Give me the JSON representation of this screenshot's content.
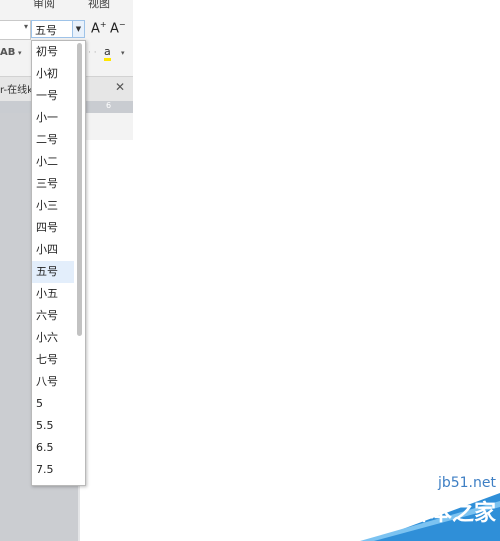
{
  "ribbon": {
    "tabs": [
      {
        "label": "审阅"
      },
      {
        "label": "视图"
      }
    ]
  },
  "toolbar": {
    "font_size_value": "五号",
    "grow_label": "A",
    "shrink_label": "A",
    "ab_label": "AB"
  },
  "doc_tab": {
    "title": "r-在线k"
  },
  "ruler": {
    "number": "6"
  },
  "font_size_dropdown": {
    "selected": "五号",
    "items": [
      "初号",
      "小初",
      "一号",
      "小一",
      "二号",
      "小二",
      "三号",
      "小三",
      "四号",
      "小四",
      "五号",
      "小五",
      "六号",
      "小六",
      "七号",
      "八号",
      "5",
      "5.5",
      "6.5",
      "7.5"
    ]
  },
  "watermark": {
    "site": "jb51.net",
    "name": "脚本之家"
  },
  "colors": {
    "accent_blue": "#3e7fc4",
    "selected_item_bg": "#e3eefb",
    "doc_background": "#cbcdd1"
  }
}
